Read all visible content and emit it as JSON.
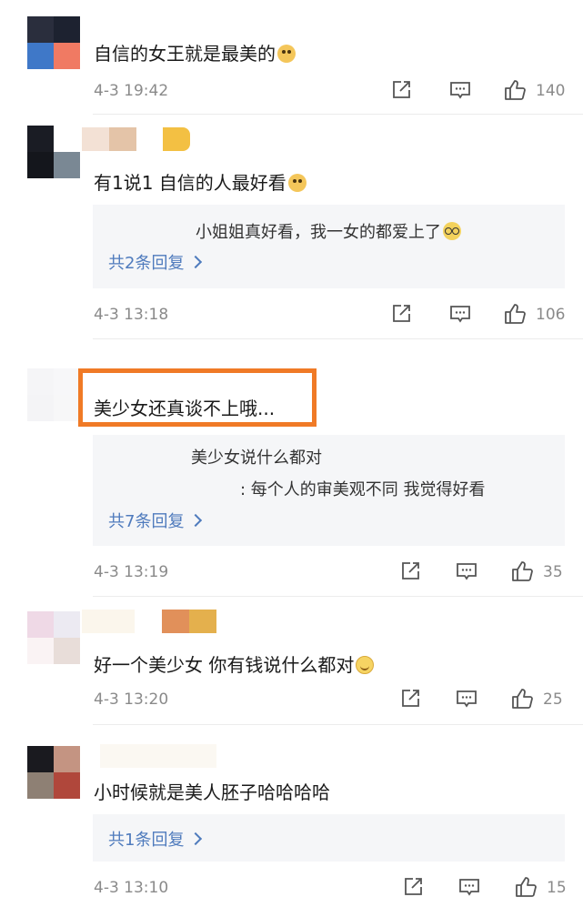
{
  "comments": [
    {
      "text": "自信的女王就是最美的",
      "emoji": "doge",
      "time": "4-3 19:42",
      "likes": "140",
      "avatar_colors": [
        "#2a2e3d",
        "#1d2230",
        "#3f78c8",
        "#f07a63"
      ]
    },
    {
      "text": "有1说1 自信的人最好看",
      "emoji": "doge",
      "time": "4-3 13:18",
      "likes": "106",
      "avatar_colors": [
        "#1a1c24",
        "#ffffff",
        "#14161c",
        "#7a8894"
      ],
      "replies": [
        {
          "text": "小姐姐真好看，我一女的都爱上了",
          "emoji": "glasses"
        }
      ],
      "more": "共2条回复"
    },
    {
      "text": "美少女还真谈不上哦...",
      "time": "4-3 13:19",
      "likes": "35",
      "avatar_colors": [
        "#f5f5f7",
        "#f7f7f9",
        "#f4f4f6",
        "#f7f7f8"
      ],
      "replies": [
        {
          "text": "美少女说什么都对"
        },
        {
          "text": ": 每个人的审美观不同 我觉得好看"
        }
      ],
      "more": "共7条回复"
    },
    {
      "text": "好一个美少女 你有钱说什么都对",
      "emoji": "smile",
      "time": "4-3 13:20",
      "likes": "25",
      "avatar_colors": [
        "#efd9e6",
        "#eceaf2",
        "#faf3f4",
        "#e8ddd9"
      ]
    },
    {
      "text": "小时候就是美人胚子哈哈哈哈",
      "time": "4-3 13:10",
      "likes": "15",
      "avatar_colors": [
        "#1a1a1f",
        "#c49482",
        "#8e8074",
        "#b0473b"
      ],
      "more": "共1条回复"
    }
  ],
  "colors": {
    "link": "#4f7bbd",
    "highlight": "#f07a26",
    "meta": "#8a8a8a"
  },
  "icons": [
    "share-icon",
    "reply-icon",
    "like-icon",
    "chevron-right-icon"
  ]
}
